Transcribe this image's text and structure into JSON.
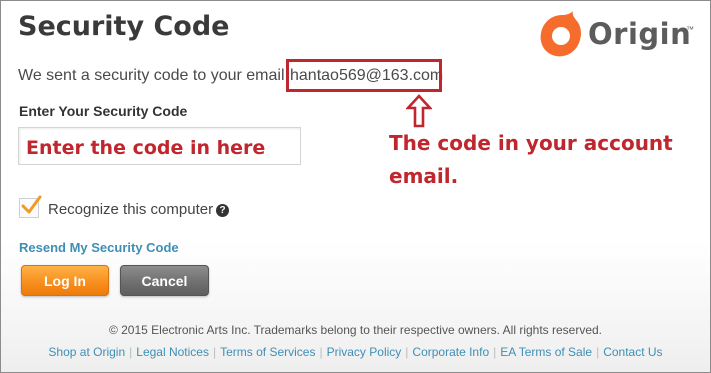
{
  "page": {
    "title": "Security Code"
  },
  "logo": {
    "brand": "Origin",
    "trademark": "™",
    "icon": "origin-logo-icon",
    "brand_color": "#f56c2d"
  },
  "message": {
    "prefix": "We sent a security code to your email ",
    "email": "hantao569@163.com"
  },
  "form": {
    "code_label": "Enter Your Security Code",
    "code_value": "Enter the code in here",
    "recognize_label": "Recognize this computer",
    "recognize_checked": true,
    "help_icon": "question-circle-icon",
    "help_glyph": "?",
    "resend_label": "Resend My Security Code",
    "login_label": "Log In",
    "cancel_label": "Cancel"
  },
  "annotation": {
    "text": "The code in your account email.",
    "color": "#c0262d",
    "arrow_icon": "up-arrow-icon"
  },
  "footer": {
    "copyright": "© 2015 Electronic Arts Inc. Trademarks belong to their respective owners. All rights reserved.",
    "links": [
      "Shop at Origin",
      "Legal Notices",
      "Terms of Services",
      "Privacy Policy",
      "Corporate Info",
      "EA Terms of Sale",
      "Contact Us"
    ],
    "link_color": "#3e8fb5"
  }
}
